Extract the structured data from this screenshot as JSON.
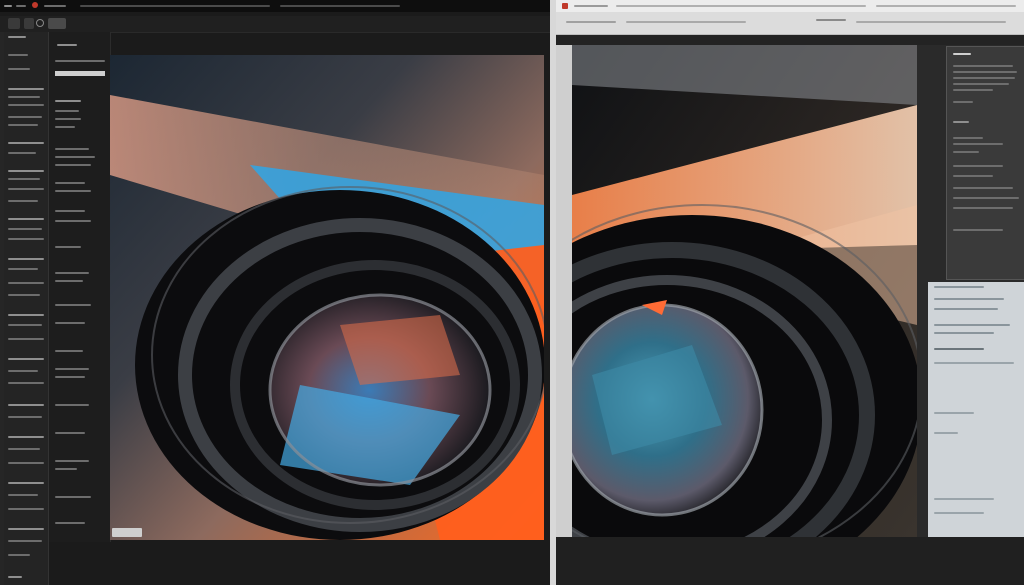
{
  "left_window": {
    "menu_items": [
      "",
      "",
      "",
      "",
      "",
      ""
    ]
  },
  "right_window": {
    "panel_bottom": {
      "heading": ""
    }
  },
  "colors": {
    "left_background": "#1b1b1b",
    "right_panel_light": "#cfd4d8",
    "accent_red": "#c0392b"
  },
  "icons": {
    "left_close": "close-icon",
    "left_search": "search-icon",
    "right_app": "app-icon"
  }
}
